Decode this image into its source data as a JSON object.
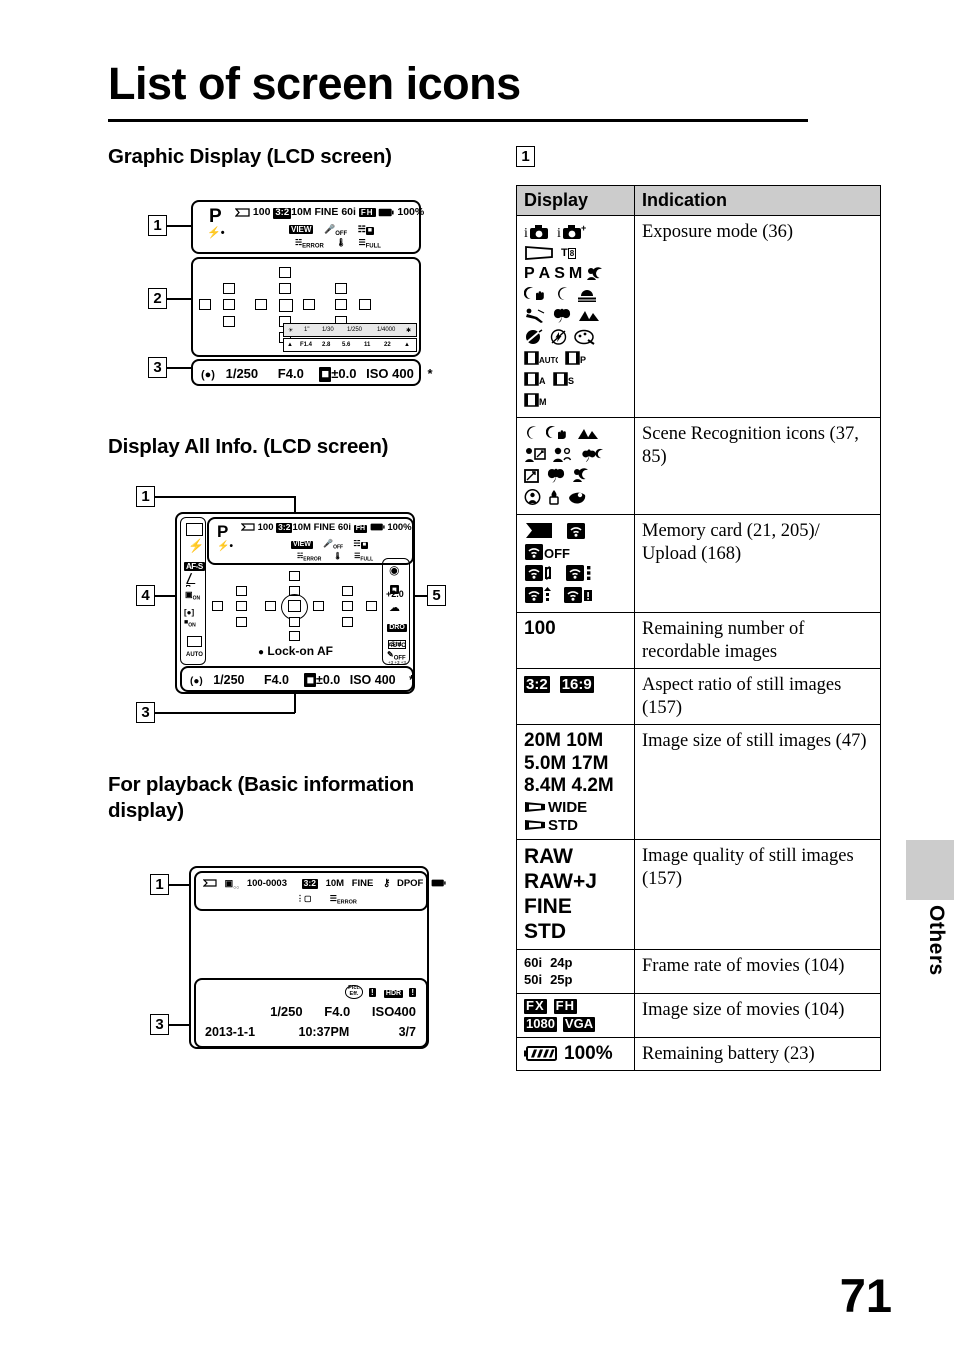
{
  "page": {
    "title": "List of screen icons",
    "page_number": "71",
    "side_tab_label": "Others"
  },
  "sections": {
    "graphic_display": "Graphic Display (LCD screen)",
    "display_all_info": "Display All Info. (LCD screen)",
    "playback": "For playback (Basic information display)"
  },
  "callouts": {
    "one": "1",
    "two": "2",
    "three": "3",
    "four": "4",
    "five": "5"
  },
  "screens": {
    "graphic": {
      "mode": "P",
      "flash": "flash-ready-icon",
      "card": "memory-card-icon",
      "remaining": "100",
      "aspect": "3:2",
      "image_size": "10M",
      "quality": "FINE",
      "framerate": "60i",
      "movie_size": "FH",
      "battery_icon": "battery-icon",
      "battery": "100%",
      "view_badge": "VIEW",
      "mic_off": "OFF",
      "steady_icons": "steadyshot-smartteleconv",
      "steady_error": "ERROR",
      "overheat": "overheat-icon",
      "db_full": "FULL",
      "scale": {
        "shutter_ticks": [
          "1\"",
          "1/30",
          "1/250",
          "1/4000"
        ],
        "aperture_ticks": [
          "F1.4",
          "2.8",
          "5.6",
          "11",
          "22"
        ]
      },
      "bottom": {
        "af_icon": "af-lock-icon",
        "shutter": "1/250",
        "aperture": "F4.0",
        "ev_icon": "ev-icon",
        "ev": "±0.0",
        "iso": "ISO 400",
        "ae_lock": "*"
      }
    },
    "all_info": {
      "mode": "P",
      "remaining": "100",
      "aspect": "3:2",
      "image_size": "10M",
      "quality": "FINE",
      "framerate": "60i",
      "movie_size": "FH",
      "battery": "100%",
      "view_badge": "VIEW",
      "mic_off": "OFF",
      "steady_error": "ERROR",
      "db_full": "FULL",
      "left_column": [
        "drive-mode-icon",
        "flash-mode-icon",
        "AF-S",
        "focus-area-icon",
        "face-detection-on-icon",
        "smile-shutter-on-icon",
        "AUTO"
      ],
      "right_column": [
        "metering-mode-icon",
        "exposure-comp-icon",
        "white-balance-cloudy-icon",
        "dro-auto-icon",
        "creative-style-std-icon",
        "picture-effect-off-icon"
      ],
      "exposure_comp": "+2.0",
      "dro": "DRO",
      "dro_sub": "AUTO",
      "style": "Std.",
      "style_sub": "+3 +3 +3",
      "effect_off": "OFF",
      "lock_on_af": "Lock-on AF",
      "bottom": {
        "shutter": "1/250",
        "aperture": "F4.0",
        "ev": "±0.0",
        "iso": "ISO 400",
        "ae_lock": "*"
      }
    },
    "playback": {
      "card_icon": "memory-card-icon",
      "protect_icon": "view-mode-icon",
      "folder_file": "100-0003",
      "aspect": "3:2",
      "image_size": "10M",
      "quality": "FINE",
      "protect": "key-icon",
      "dpof": "DPOF",
      "battery_icon": "battery-icon",
      "smart_zoom": "smart-zoom-icon",
      "db_error": "ERROR",
      "picteffect_badge": "Pict.\nEff.",
      "warn1": "!",
      "hdr_badge": "HDR",
      "warn2": "!",
      "shutter": "1/250",
      "aperture": "F4.0",
      "iso": "ISO400",
      "date": "2013-1-1",
      "time": "10:37PM",
      "counter": "3/7"
    }
  },
  "table": {
    "headers": {
      "display": "Display",
      "indication": "Indication"
    },
    "rows": [
      {
        "id": "exposure-mode",
        "display_kind": "icons",
        "display_lines": [
          [
            "i-auto-icon",
            "i-auto-plus-icon"
          ],
          [
            "sweep-panorama-icon",
            "T",
            "continuous-priority-ae-icon"
          ],
          [
            "P",
            "A",
            "S",
            "M",
            "night-portrait-icon"
          ],
          [
            "hand-held-twilight-icon",
            "night-scene-icon",
            "sunset-icon"
          ],
          [
            "sports-action-icon",
            "macro-icon",
            "landscape-icon"
          ],
          [
            "anti-motion-blur-icon",
            "flash-off-icon",
            "picture-effect-icon"
          ],
          [
            "movie-auto-icon",
            "movie-p-icon"
          ],
          [
            "movie-a-icon",
            "movie-s-icon"
          ],
          [
            "movie-m-icon"
          ]
        ],
        "indication": "Exposure mode (36)"
      },
      {
        "id": "scene-recognition",
        "display_kind": "icons",
        "display_lines": [
          [
            "night-scene-icon",
            "hand-held-twilight-icon",
            "landscape-icon"
          ],
          [
            "backlight-portrait-icon",
            "portrait-icon",
            "night-macro-icon"
          ],
          [
            "backlight-icon",
            "macro-icon",
            "night-portrait-icon"
          ],
          [
            "spotlight-icon",
            "low-light-icon",
            "tripod-icon"
          ]
        ],
        "indication": "Scene Recognition icons (37, 85)"
      },
      {
        "id": "memory-card-upload",
        "display_kind": "icons",
        "display_lines": [
          [
            "memory-card-icon",
            "wifi-card-icon"
          ],
          [
            "wifi-card-off-icon"
          ],
          [
            "wifi-card-connecting-icon",
            "wifi-card-standby-icon"
          ],
          [
            "wifi-card-uploading-icon",
            "wifi-card-error-icon"
          ]
        ],
        "indication": "Memory card (21, 205)/ Upload (168)"
      },
      {
        "id": "remaining-images",
        "display_kind": "text-big",
        "display_text": [
          "100"
        ],
        "indication": "Remaining number of recordable images"
      },
      {
        "id": "aspect-ratio",
        "display_kind": "inverse-badges",
        "display_text": [
          "3:2",
          "16:9"
        ],
        "indication": "Aspect ratio of still images (157)"
      },
      {
        "id": "image-size-still",
        "display_kind": "text-big-multi",
        "display_text": [
          "20M 10M",
          "5.0M 17M",
          "8.4M 4.2M"
        ],
        "display_extra": [
          "WIDE",
          "STD"
        ],
        "indication": "Image size of still images (47)"
      },
      {
        "id": "image-quality-still",
        "display_kind": "text-big-multi",
        "display_text": [
          "RAW",
          "RAW+J",
          "FINE",
          "STD"
        ],
        "indication": "Image quality of still images (157)"
      },
      {
        "id": "frame-rate-movies",
        "display_kind": "text-small-grid",
        "display_text": [
          "60i",
          "24p",
          "50i",
          "25p"
        ],
        "indication": "Frame rate of movies (104)"
      },
      {
        "id": "image-size-movies",
        "display_kind": "inverse-badges-grid",
        "display_text": [
          "FX",
          "FH",
          "1080",
          "VGA"
        ],
        "indication": "Image size of movies (104)"
      },
      {
        "id": "remaining-battery",
        "display_kind": "battery",
        "display_text": [
          "100%"
        ],
        "indication": "Remaining battery (23)"
      }
    ]
  }
}
